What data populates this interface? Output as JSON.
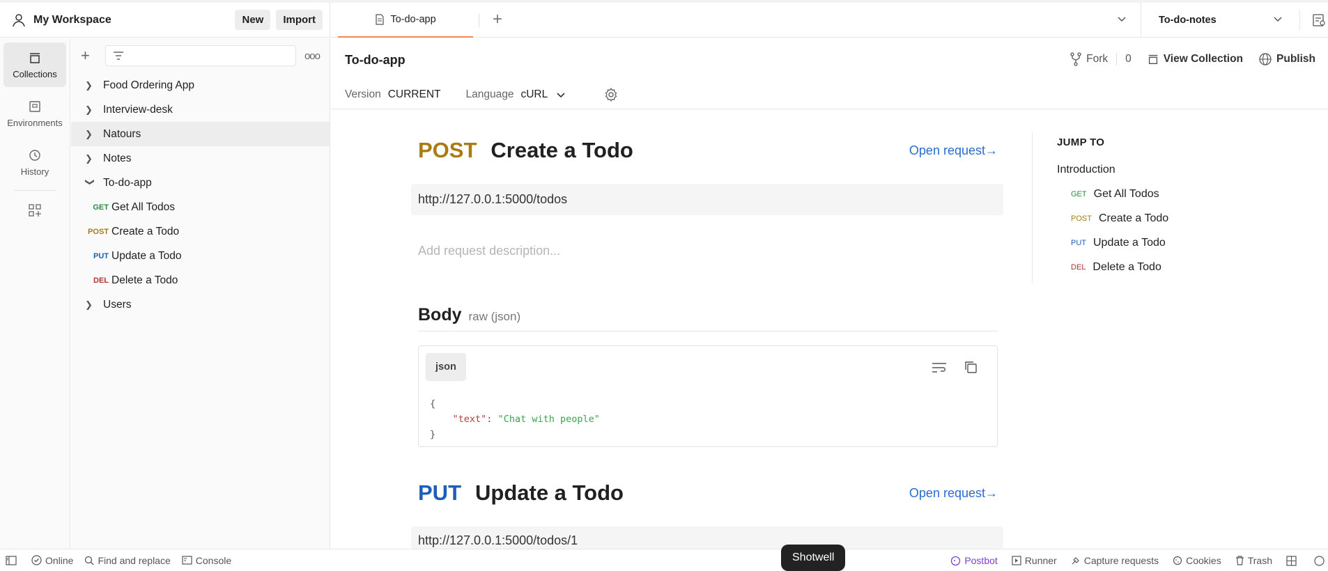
{
  "workspace": {
    "title": "My Workspace",
    "new_label": "New",
    "import_label": "Import"
  },
  "rail": [
    {
      "label": "Collections",
      "icon": "collections-icon"
    },
    {
      "label": "Environments",
      "icon": "environments-icon"
    },
    {
      "label": "History",
      "icon": "history-icon"
    }
  ],
  "tree": {
    "collections": [
      {
        "name": "Food Ordering App"
      },
      {
        "name": "Interview-desk"
      },
      {
        "name": "Natours"
      },
      {
        "name": "Notes"
      },
      {
        "name": "To-do-app"
      },
      {
        "name": "Users"
      }
    ],
    "requests": [
      {
        "method": "GET",
        "name": "Get All Todos"
      },
      {
        "method": "POST",
        "name": "Create a Todo"
      },
      {
        "method": "PUT",
        "name": "Update a Todo"
      },
      {
        "method": "DEL",
        "name": "Delete a Todo"
      }
    ]
  },
  "tab": {
    "label": "To-do-app"
  },
  "env": {
    "name": "To-do-notes"
  },
  "doc": {
    "title": "To-do-app",
    "fork_label": "Fork",
    "fork_count": "0",
    "view_collection": "View Collection",
    "publish": "Publish",
    "version_label": "Version",
    "version_value": "CURRENT",
    "language_label": "Language",
    "language_value": "cURL"
  },
  "requests": [
    {
      "method": "POST",
      "title": "Create a Todo",
      "open": "Open request→",
      "url": "http://127.0.0.1:5000/todos",
      "description_placeholder": "Add request description...",
      "body_label": "Body",
      "body_type": "raw (json)",
      "lang": "json",
      "code_open": "{",
      "code_key": "\"text\"",
      "code_colon": ": ",
      "code_value": "\"Chat with people\"",
      "code_close": "}"
    },
    {
      "method": "PUT",
      "title": "Update a Todo",
      "open": "Open request→",
      "url": "http://127.0.0.1:5000/todos/1"
    }
  ],
  "jump": {
    "heading": "JUMP TO",
    "intro": "Introduction",
    "items": [
      {
        "method": "GET",
        "name": "Get All Todos"
      },
      {
        "method": "POST",
        "name": "Create a Todo"
      },
      {
        "method": "PUT",
        "name": "Update a Todo"
      },
      {
        "method": "DEL",
        "name": "Delete a Todo"
      }
    ]
  },
  "status": {
    "online": "Online",
    "find": "Find and replace",
    "console": "Console",
    "postbot": "Postbot",
    "runner": "Runner",
    "capture": "Capture requests",
    "cookies": "Cookies",
    "trash": "Trash"
  },
  "tooltip": "Shotwell",
  "colors": {
    "get": "#2b8a3e",
    "post": "#a87b13",
    "put": "#1d5fb8",
    "del": "#b83232",
    "accent": "#f28a4f",
    "link": "#2a6ad1"
  }
}
